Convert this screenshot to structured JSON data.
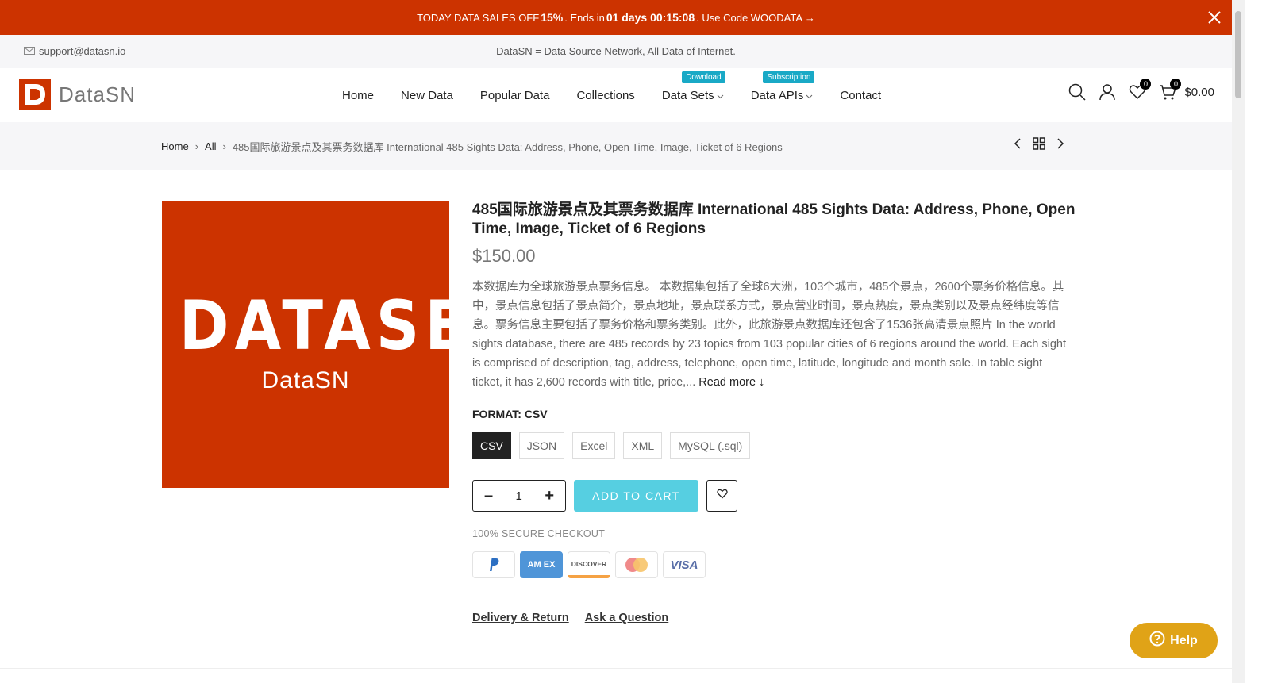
{
  "promo": {
    "text_before": "TODAY DATA SALES OFF ",
    "discount": "15%",
    "ends_label": ". Ends in ",
    "countdown": "01 days 00:15:08",
    "code_text": ". Use Code WOODATA →"
  },
  "topbar": {
    "email": "support@datasn.io",
    "tagline": "DataSN = Data Source Network, All Data of Internet."
  },
  "header": {
    "logo_text": "DataSN",
    "nav": [
      {
        "label": "Home"
      },
      {
        "label": "New Data"
      },
      {
        "label": "Popular Data"
      },
      {
        "label": "Collections"
      },
      {
        "label": "Data Sets",
        "badge": "Download"
      },
      {
        "label": "Data APIs",
        "badge": "Subscription"
      },
      {
        "label": "Contact"
      }
    ],
    "wishlist_count": "0",
    "cart_count": "0",
    "cart_total": "$0.00"
  },
  "breadcrumb": {
    "home": "Home",
    "all": "All",
    "current": "485国际旅游景点及其票务数据库 International 485 Sights Data: Address, Phone, Open Time, Image, Ticket of 6 Regions"
  },
  "product": {
    "image_big_text": "DATASET",
    "image_small_text": "DataSN",
    "title": "485国际旅游景点及其票务数据库 International 485 Sights Data: Address, Phone, Open Time, Image, Ticket of 6 Regions",
    "price": "$150.00",
    "description": "本数据库为全球旅游景点票务信息。 本数据集包括了全球6大洲，103个城市，485个景点，2600个票务价格信息。其中，景点信息包括了景点简介，景点地址，景点联系方式，景点营业时间，景点热度，景点类别以及景点经纬度等信息。票务信息主要包括了票务价格和票务类别。此外，此旅游景点数据库还包含了1536张高清景点照片 In the world sights database, there are 485 records by 23 topics from 103 popular cities of 6 regions around the world. Each sight is comprised of description, tag, address, telephone, open time, latitude, longitude and month sale. In table sight ticket, it has 2,600 records with title, price,...",
    "read_more": "Read more ↓",
    "format_label": "FORMAT: CSV",
    "formats": [
      "CSV",
      "JSON",
      "Excel",
      "XML",
      "MySQL (.sql)"
    ],
    "quantity": "1",
    "add_to_cart": "ADD TO CART",
    "secure_checkout": "100% SECURE CHECKOUT",
    "payment_methods": [
      "PayPal",
      "AMEX",
      "DISCOVER",
      "MasterCard",
      "VISA"
    ],
    "links": [
      "Delivery & Return",
      "Ask a Question"
    ]
  },
  "help_button": "Help",
  "colors": {
    "brand": "#cc3300",
    "badge": "#19a9c6",
    "add_to_cart": "#56cfe1",
    "help": "#e0a317"
  }
}
